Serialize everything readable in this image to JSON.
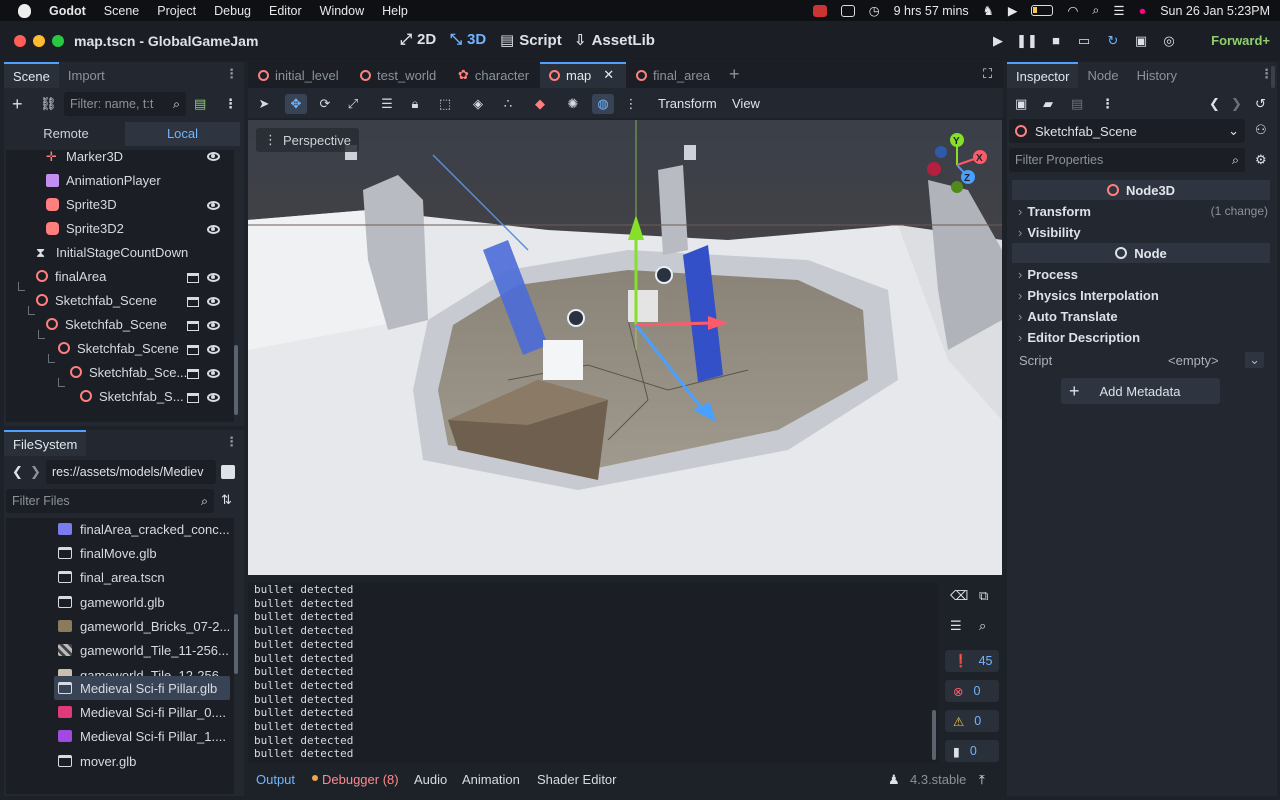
{
  "menubar": {
    "app": "Godot",
    "items": [
      "Scene",
      "Project",
      "Debug",
      "Editor",
      "Window",
      "Help"
    ],
    "battery_time": "9 hrs 57 mins",
    "datetime": "Sun 26 Jan  5:23PM"
  },
  "titlebar": {
    "scene_title": "map.tscn - GlobalGameJam",
    "workspaces": [
      "2D",
      "3D",
      "Script",
      "AssetLib"
    ],
    "active_workspace": "3D",
    "renderer": "Forward+"
  },
  "scene_dock": {
    "tabs": [
      "Scene",
      "Import"
    ],
    "filter_placeholder": "Filter: name, t:t",
    "remote_label": "Remote",
    "local_label": "Local",
    "nodes": [
      {
        "label": "Marker3D",
        "icon": "marker3d-icon",
        "color": "#ff7f7f"
      },
      {
        "label": "AnimationPlayer",
        "icon": "animation-player-icon",
        "color": "#c38ef1"
      },
      {
        "label": "Sprite3D",
        "icon": "sprite3d-icon",
        "color": "#ff7f7f"
      },
      {
        "label": "Sprite3D2",
        "icon": "sprite3d-icon",
        "color": "#ff7f7f"
      },
      {
        "label": "InitialStageCountDown",
        "icon": "timer-icon",
        "color": "#e0e0e0"
      },
      {
        "label": "finalArea",
        "icon": "node3d-icon",
        "color": "#ff7f7f"
      },
      {
        "label": "Sketchfab_Scene",
        "icon": "node3d-icon",
        "color": "#ff7f7f"
      },
      {
        "label": "Sketchfab_Scene",
        "icon": "node3d-icon",
        "color": "#ff7f7f"
      },
      {
        "label": "Sketchfab_Scene",
        "icon": "node3d-icon",
        "color": "#ff7f7f"
      },
      {
        "label": "Sketchfab_Sce...",
        "icon": "node3d-icon",
        "color": "#ff7f7f"
      },
      {
        "label": "Sketchfab_S...",
        "icon": "node3d-icon",
        "color": "#ff7f7f"
      }
    ]
  },
  "filesystem_dock": {
    "tab": "FileSystem",
    "path": "res://assets/models/Mediev",
    "filter_placeholder": "Filter Files",
    "files": [
      {
        "label": "finalArea_cracked_conc...",
        "icon": "texture-icon",
        "color": "#7b7bf0"
      },
      {
        "label": "finalMove.glb",
        "icon": "scene-file-icon",
        "color": "#e0e0e0"
      },
      {
        "label": "final_area.tscn",
        "icon": "scene-file-icon",
        "color": "#e0e0e0"
      },
      {
        "label": "gameworld.glb",
        "icon": "scene-file-icon",
        "color": "#e0e0e0"
      },
      {
        "label": "gameworld_Bricks_07-2...",
        "icon": "texture-icon",
        "color": "#8b7a5c"
      },
      {
        "label": "gameworld_Tile_11-256...",
        "icon": "texture-icon",
        "color": "#b0b0b0"
      },
      {
        "label": "gameworld_Tile_12-256...",
        "icon": "texture-icon",
        "color": "#c8bfae"
      },
      {
        "label": "Medieval Sci-fi Pillar.glb",
        "icon": "scene-file-icon",
        "color": "#e0e0e0"
      },
      {
        "label": "Medieval Sci-fi Pillar_0....",
        "icon": "texture-icon",
        "color": "#e03a7a"
      },
      {
        "label": "Medieval Sci-fi Pillar_1....",
        "icon": "texture-icon",
        "color": "#a04ae0"
      },
      {
        "label": "mover.glb",
        "icon": "scene-file-icon",
        "color": "#e0e0e0"
      }
    ],
    "selected_index": 7
  },
  "scene_tabs": {
    "tabs": [
      "initial_level",
      "test_world",
      "character",
      "map",
      "final_area"
    ],
    "active": "map"
  },
  "viewport": {
    "menu_transform": "Transform",
    "menu_view": "View",
    "perspective_label": "Perspective",
    "gizmo_axes": [
      "Y",
      "X",
      "Z"
    ]
  },
  "output": {
    "lines": [
      "bullet detected",
      "bullet detected",
      "bullet detected",
      "bullet detected",
      "bullet detected",
      "bullet detected",
      "bullet detected",
      "bullet detected",
      "bullet detected",
      "bullet detected",
      "bullet detected",
      "bullet detected",
      "bullet detected"
    ],
    "counts": {
      "messages": "45",
      "errors": "0",
      "warnings": "0",
      "editor": "0"
    },
    "bottom_tabs": [
      "Output",
      "Debugger (8)",
      "Audio",
      "Animation",
      "Shader Editor"
    ],
    "version": "4.3.stable"
  },
  "inspector": {
    "tabs": [
      "Inspector",
      "Node",
      "History"
    ],
    "object_name": "Sketchfab_Scene",
    "filter_placeholder": "Filter Properties",
    "section_node3d": "Node3D",
    "transform_label": "Transform",
    "transform_note": "(1 change)",
    "visibility_label": "Visibility",
    "section_node": "Node",
    "node_props": [
      "Process",
      "Physics Interpolation",
      "Auto Translate",
      "Editor Description"
    ],
    "script_label": "Script",
    "script_value": "<empty>",
    "add_metadata": "Add Metadata"
  },
  "colors": {
    "accent": "#4fa0ff",
    "node3d": "#ff7f7f",
    "renderer": "#8fcf6f"
  }
}
